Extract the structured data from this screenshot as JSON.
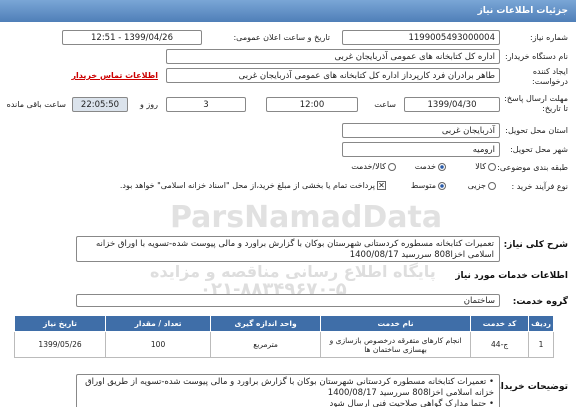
{
  "header": {
    "title": "جزئیات اطلاعات نیاز"
  },
  "fields": {
    "need_number_label": "شماره نیاز:",
    "need_number": "1199005493000004",
    "announce_label": "تاریخ و ساعت اعلان عمومی:",
    "announce_value": "1399/04/26 - 12:51",
    "buyer_label": "نام دستگاه خریدار:",
    "buyer_value": "اداره کل کتابخانه های عمومی آذربایجان غربی",
    "creator_label_1": "ایجاد کننده",
    "creator_label_2": "درخواست:",
    "creator_value": "طاهر برادران فرد کارپرداز اداره کل کتابخانه های عمومی آذربایجان غربی",
    "contact_link": "اطلاعات تماس خریدار",
    "deadline_label_1": "مهلت ارسال پاسخ:",
    "deadline_label_2": "تا تاریخ:",
    "deadline_date": "1399/04/30",
    "time_label": "ساعت",
    "deadline_time": "12:00",
    "days_value": "3",
    "days_label": "روز و",
    "remaining_time": "22:05:50",
    "remaining_label": "ساعت باقی مانده",
    "province_label": "استان محل تحویل:",
    "province_value": "آذربایجان غربی",
    "city_label": "شهر محل تحویل:",
    "city_value": "ارومیه",
    "category_label": "طبقه بندی موضوعی:",
    "category_opt1": "کالا",
    "category_opt2": "خدمت",
    "category_opt3": "کالا/خدمت",
    "process_label": "نوع فرآیند خرید :",
    "process_opt1": "جزیی",
    "process_opt2": "متوسط",
    "process_note": "پرداخت تمام یا بخشی از مبلغ خرید،از محل \"اسناد خزانه اسلامی\" خواهد بود."
  },
  "summary": {
    "label": "شرح کلی نیاز:",
    "text": "تعمیرات کتابخانه مسطوره کردستانی شهرستان بوکان با گزارش براورد و مالی پیوست شده-تسویه با اوراق خزانه اسلامی اخزا808 سررسید 1400/08/17"
  },
  "services": {
    "section_title": "اطلاعات خدمات مورد نیاز",
    "group_label": "گروه خدمت:",
    "group_value": "ساختمان",
    "columns": [
      "ردیف",
      "کد خدمت",
      "نام خدمت",
      "واحد اندازه گیری",
      "تعداد / مقدار",
      "تاریخ نیاز"
    ],
    "rows": [
      {
        "row": "1",
        "code": "ج-44",
        "name": "انجام کارهای متفرقه درخصوص بازسازی و بهسازی ساختمان ها",
        "unit": "مترمربع",
        "qty": "100",
        "date": "1399/05/26"
      }
    ]
  },
  "buyer_notes": {
    "label": "توضیحات خریدار:",
    "lines": [
      "تعمیرات کتابخانه مسطوره کردستانی شهرستان بوکان با گزارش براورد و مالی پیوست شده-تسویه از طریق اوراق خزانه اسلامی اخزا808 سررسید 1400/08/17",
      "حتما مدارک گواهی صلاحیت فنی ارسال شود"
    ]
  },
  "watermarks": {
    "brand": "ParsNamadData",
    "line1": "پایگاه اطلاع رسانی مناقصه و مزایده",
    "line2": "۰۲۱-۸۸۳۴۹۶۷۰-۵"
  }
}
